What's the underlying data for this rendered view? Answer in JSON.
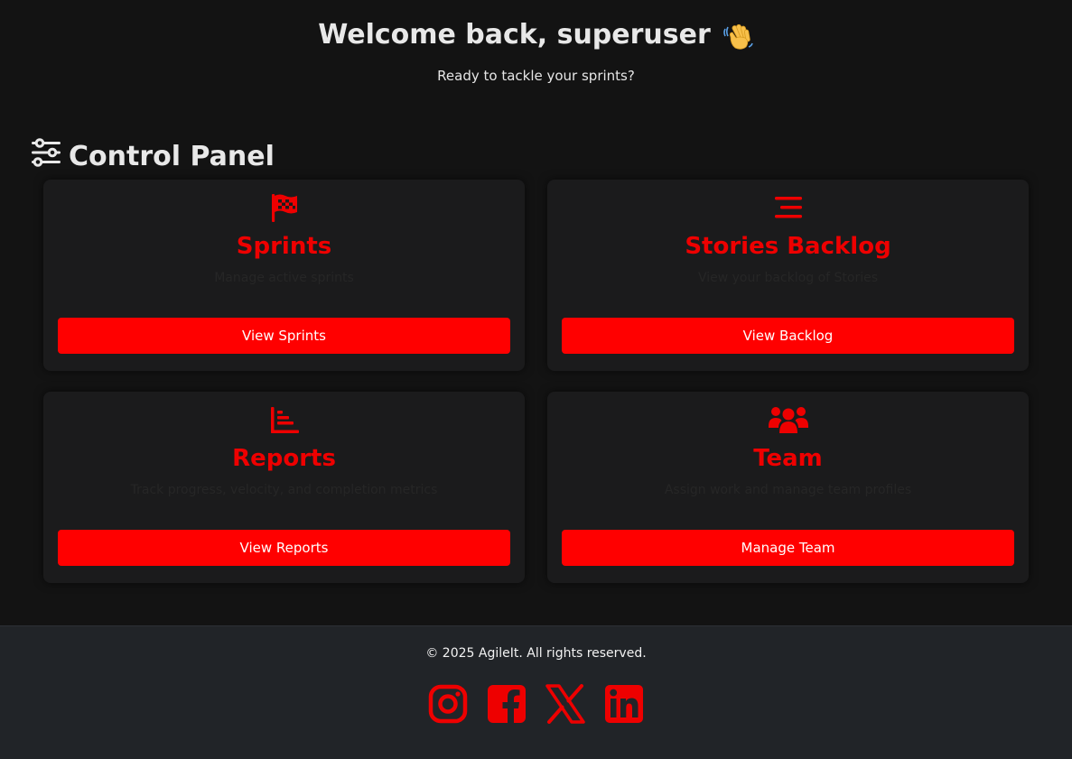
{
  "header": {
    "title": "Welcome back, superuser",
    "subtitle": "Ready to tackle your sprints?"
  },
  "panel": {
    "title": "Control Panel",
    "icon": "sliders-icon"
  },
  "cards": [
    {
      "icon": "checkered-flag-icon",
      "title": "Sprints",
      "description": "Manage active sprints",
      "button": "View Sprints"
    },
    {
      "icon": "list-lines-icon",
      "title": "Stories Backlog",
      "description": "View your backlog of Stories",
      "button": "View Backlog"
    },
    {
      "icon": "bar-chart-icon",
      "title": "Reports",
      "description": "Track progress, velocity, and completion metrics",
      "button": "View Reports"
    },
    {
      "icon": "users-icon",
      "title": "Team",
      "description": "Assign work and manage team profiles",
      "button": "Manage Team"
    }
  ],
  "footer": {
    "copyright": "© 2025 AgileIt. All rights reserved.",
    "socials": [
      "instagram-icon",
      "facebook-icon",
      "x-icon",
      "linkedin-icon"
    ]
  },
  "colors": {
    "accent": "#ff0000",
    "title_red": "#ee0000",
    "background": "#131313",
    "card": "#1b1b1c",
    "footer": "#212428"
  }
}
